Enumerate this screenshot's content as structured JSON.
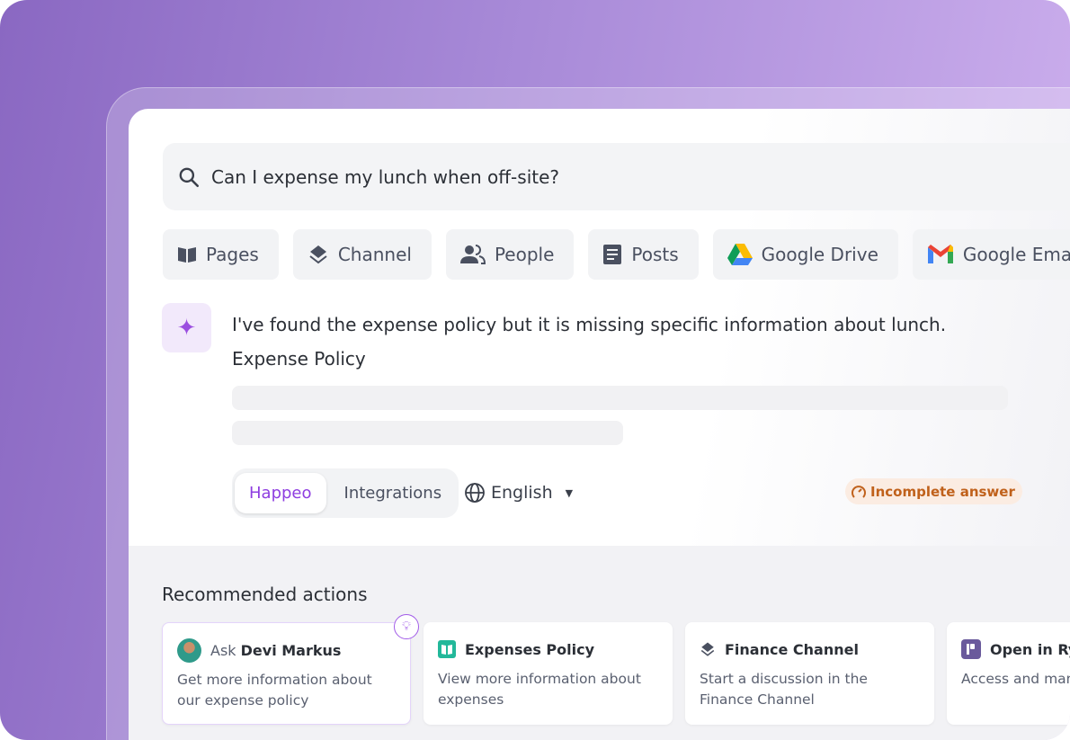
{
  "search": {
    "query": "Can I expense my lunch when off-site?",
    "icon": "search-icon"
  },
  "filters": [
    {
      "label": "Pages",
      "icon": "book-icon"
    },
    {
      "label": "Channel",
      "icon": "layers-icon"
    },
    {
      "label": "People",
      "icon": "people-icon"
    },
    {
      "label": "Posts",
      "icon": "document-icon"
    },
    {
      "label": "Google Drive",
      "icon": "google-drive-icon"
    },
    {
      "label": "Google Emails",
      "icon": "gmail-icon"
    }
  ],
  "answer": {
    "text": "I've found the expense policy but it is missing specific information about lunch.",
    "source_title": "Expense Policy",
    "tabs": [
      "Happeo",
      "Integrations"
    ],
    "active_tab": "Happeo",
    "language": "English",
    "status": "Incomplete answer"
  },
  "colors": {
    "accent": "#8e3ee0",
    "warning": "#c0611b",
    "warning_bg": "#fbece2"
  },
  "recommended": {
    "title": "Recommended actions",
    "items": [
      {
        "prefix": "Ask",
        "title": "Devi Markus",
        "desc": "Get more information about our expense policy",
        "icon": "avatar"
      },
      {
        "title": "Expenses Policy",
        "desc": "View more information about expenses",
        "icon": "book-icon"
      },
      {
        "title": "Finance Channel",
        "desc": "Start a discussion in the Finance Channel",
        "icon": "layers-icon"
      },
      {
        "title": "Open in Rydoo",
        "desc": "Access and manage via Rydoo",
        "icon": "rydoo-icon"
      }
    ]
  }
}
